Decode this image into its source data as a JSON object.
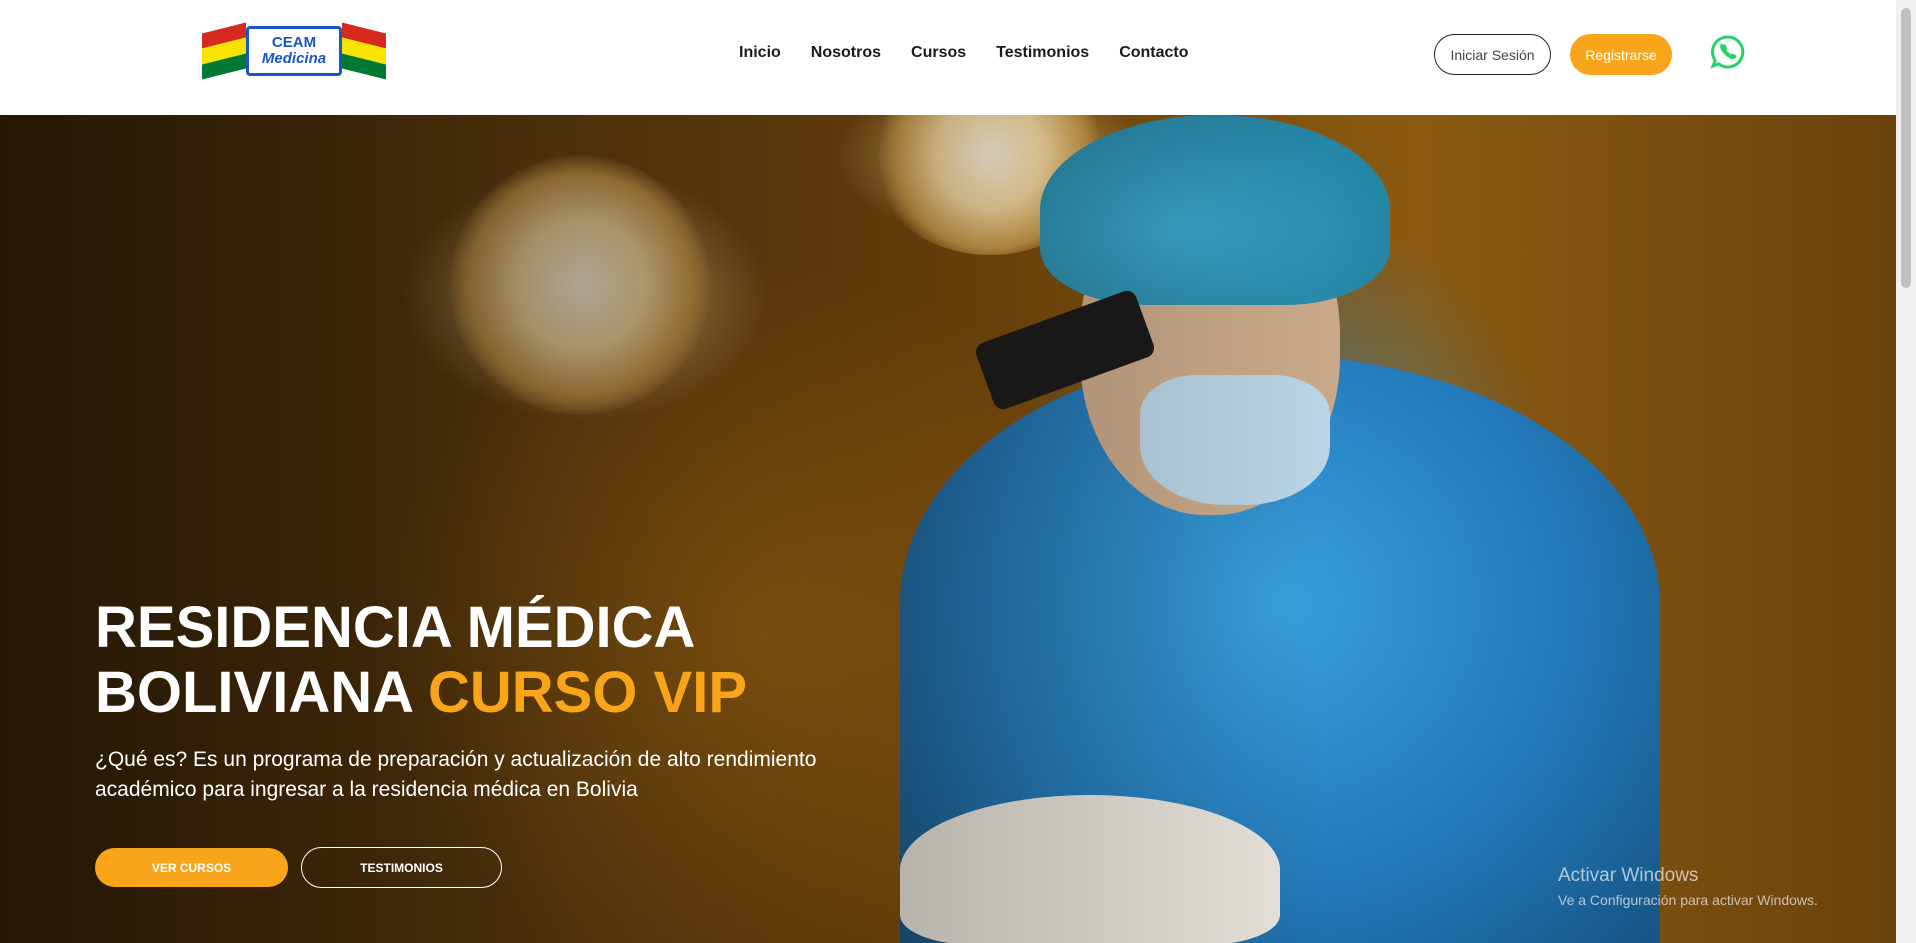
{
  "header": {
    "logo": {
      "line1": "CEAM",
      "line2": "Medicina"
    },
    "nav": [
      {
        "label": "Inicio"
      },
      {
        "label": "Nosotros"
      },
      {
        "label": "Cursos"
      },
      {
        "label": "Testimonios"
      },
      {
        "label": "Contacto"
      }
    ],
    "login_label": "Iniciar Sesión",
    "register_label": "Registrarse",
    "whatsapp_icon": "whatsapp-icon"
  },
  "hero": {
    "title_white_1": "RESIDENCIA MÉDICA",
    "title_white_2": "BOLIVIANA ",
    "title_accent": "CURSO VIP",
    "description": "¿Qué es? Es un programa de preparación y actualización de alto rendimiento académico para ingresar a la residencia médica en Bolivia",
    "primary_button": "VER CURSOS",
    "secondary_button": "TESTIMONIOS"
  },
  "windows_notice": {
    "title": "Activar Windows",
    "subtitle": "Ve a Configuración para activar Windows."
  },
  "colors": {
    "accent": "#f9a51c",
    "whatsapp": "#25d366",
    "brand_blue": "#1a56c4"
  }
}
